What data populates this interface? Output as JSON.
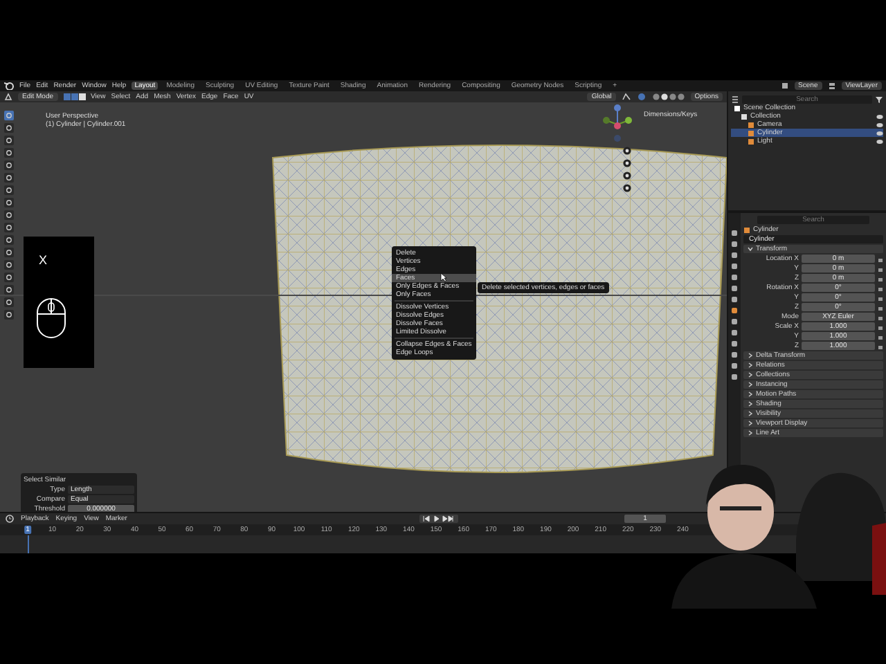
{
  "menu_bar": {
    "menus": [
      "File",
      "Edit",
      "Render",
      "Window",
      "Help"
    ],
    "workspaces": [
      {
        "label": "Layout",
        "selected": true
      },
      {
        "label": "Modeling",
        "selected": false
      },
      {
        "label": "Sculpting",
        "selected": false
      },
      {
        "label": "UV Editing",
        "selected": false
      },
      {
        "label": "Texture Paint",
        "selected": false
      },
      {
        "label": "Shading",
        "selected": false
      },
      {
        "label": "Animation",
        "selected": false
      },
      {
        "label": "Rendering",
        "selected": false
      },
      {
        "label": "Compositing",
        "selected": false
      },
      {
        "label": "Geometry Nodes",
        "selected": false
      },
      {
        "label": "Scripting",
        "selected": false
      },
      {
        "label": "+",
        "selected": false
      }
    ],
    "scene": "Scene",
    "view_layer": "ViewLayer"
  },
  "viewport_header": {
    "mode": "Edit Mode",
    "menus": [
      "View",
      "Select",
      "Add",
      "Mesh",
      "Vertex",
      "Edge",
      "Face",
      "UV"
    ],
    "orientation": "Global",
    "options": "Options"
  },
  "viewport": {
    "view_name": "User Perspective",
    "object_info": "(1) Cylinder | Cylinder.001",
    "overlay_label": "Dimensions/Keys",
    "key_overlay": {
      "key": "X"
    },
    "context_menu": {
      "title": "Delete",
      "items": [
        {
          "label": "Vertices",
          "selected": false,
          "separator_before": false
        },
        {
          "label": "Edges",
          "selected": false,
          "separator_before": false
        },
        {
          "label": "Faces",
          "selected": true,
          "separator_before": false
        },
        {
          "label": "Only Edges & Faces",
          "selected": false,
          "separator_before": false
        },
        {
          "label": "Only Faces",
          "selected": false,
          "separator_before": false
        },
        {
          "label": "Dissolve Vertices",
          "selected": false,
          "separator_before": true
        },
        {
          "label": "Dissolve Edges",
          "selected": false,
          "separator_before": false
        },
        {
          "label": "Dissolve Faces",
          "selected": false,
          "separator_before": false
        },
        {
          "label": "Limited Dissolve",
          "selected": false,
          "separator_before": false
        },
        {
          "label": "Collapse Edges & Faces",
          "selected": false,
          "separator_before": true
        },
        {
          "label": "Edge Loops",
          "selected": false,
          "separator_before": false
        }
      ],
      "tooltip": "Delete selected vertices, edges or faces"
    },
    "operator_panel": {
      "title": "Select Similar",
      "fields": [
        {
          "label": "Type",
          "value": "Length",
          "kind": "dropdown"
        },
        {
          "label": "Compare",
          "value": "Equal",
          "kind": "dropdown"
        },
        {
          "label": "Threshold",
          "value": "0.000000",
          "kind": "number"
        }
      ]
    }
  },
  "outliner": {
    "search_placeholder": "Search",
    "items": [
      {
        "label": "Scene Collection",
        "selected": false,
        "children": [
          {
            "label": "Collection",
            "selected": false,
            "children": [
              {
                "label": "Camera",
                "selected": false
              },
              {
                "label": "Cylinder",
                "selected": true
              },
              {
                "label": "Light",
                "selected": false
              }
            ]
          }
        ]
      }
    ]
  },
  "properties": {
    "search_placeholder": "Search",
    "object_name": "Cylinder",
    "data_name": "Cylinder",
    "sections": [
      {
        "title": "Transform",
        "expanded": true
      },
      {
        "title": "Delta Transform",
        "expanded": false
      },
      {
        "title": "Relations",
        "expanded": false
      },
      {
        "title": "Collections",
        "expanded": false
      },
      {
        "title": "Instancing",
        "expanded": false
      },
      {
        "title": "Motion Paths",
        "expanded": false
      },
      {
        "title": "Shading",
        "expanded": false
      },
      {
        "title": "Visibility",
        "expanded": false
      },
      {
        "title": "Viewport Display",
        "expanded": false
      },
      {
        "title": "Line Art",
        "expanded": false
      }
    ],
    "transform": [
      {
        "label": "Location X",
        "value": "0 m"
      },
      {
        "label": "Y",
        "value": "0 m"
      },
      {
        "label": "Z",
        "value": "0 m"
      },
      {
        "label": "Rotation X",
        "value": "0°"
      },
      {
        "label": "Y",
        "value": "0°"
      },
      {
        "label": "Z",
        "value": "0°"
      },
      {
        "label": "Mode",
        "value": "XYZ Euler"
      },
      {
        "label": "Scale X",
        "value": "1.000"
      },
      {
        "label": "Y",
        "value": "1.000"
      },
      {
        "label": "Z",
        "value": "1.000"
      }
    ]
  },
  "timeline": {
    "menus": [
      "Playback",
      "Keying",
      "View",
      "Marker"
    ],
    "current_frame": "1",
    "ruler": [
      "1",
      "10",
      "20",
      "30",
      "40",
      "50",
      "60",
      "70",
      "80",
      "90",
      "100",
      "110",
      "120",
      "130",
      "140",
      "150",
      "160",
      "170",
      "180",
      "190",
      "200",
      "210",
      "220",
      "230",
      "240"
    ]
  }
}
